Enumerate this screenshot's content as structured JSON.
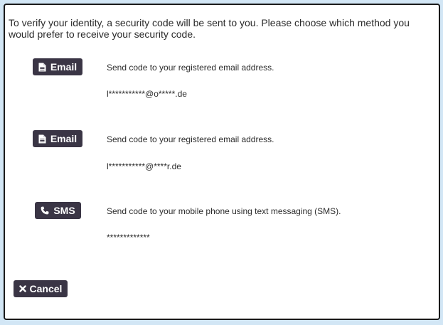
{
  "dialog": {
    "intro_text": "To verify your identity, a security code will be sent to you. Please choose which method you would prefer to receive your security code."
  },
  "methods": [
    {
      "button_label": "Email",
      "icon": "document-icon",
      "description": "Send code to your registered email address.",
      "masked_value": "l***********@o*****.de"
    },
    {
      "button_label": "Email",
      "icon": "document-icon",
      "description": "Send code to your registered email address.",
      "masked_value": "l***********@****r.de"
    },
    {
      "button_label": "SMS",
      "icon": "phone-icon",
      "description": "Send code to your mobile phone using text messaging (SMS).",
      "masked_value": "*************"
    }
  ],
  "footer": {
    "cancel_label": "Cancel",
    "cancel_icon": "close-icon"
  },
  "colors": {
    "background": "#d2e6f5",
    "panel": "#ffffff",
    "button": "#3a3545",
    "text": "#2b2b2b"
  }
}
